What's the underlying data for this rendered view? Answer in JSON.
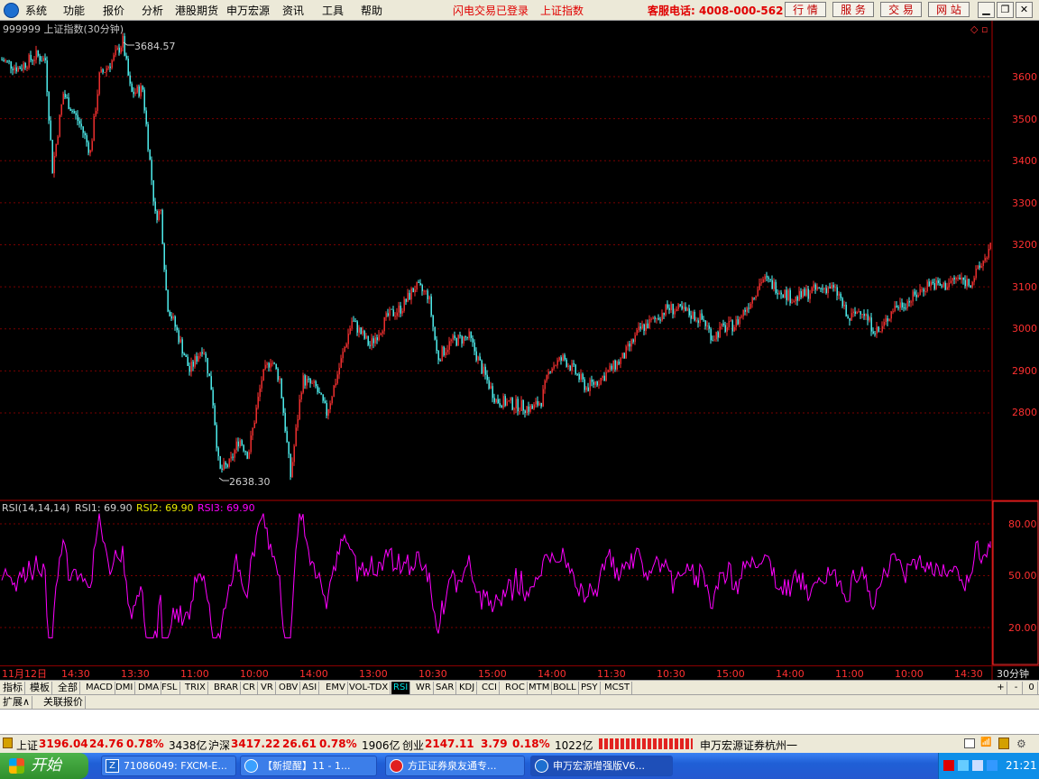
{
  "menu": {
    "items": [
      "系统",
      "功能",
      "报价",
      "分析",
      "港股期货",
      "申万宏源",
      "资讯",
      "工具",
      "帮助"
    ],
    "status1": "闪电交易已登录",
    "status2": "上证指数",
    "hotline": "客服电话: 4008-000-562",
    "nav_buttons": [
      "行 情",
      "服 务",
      "交 易",
      "网 站"
    ]
  },
  "chart": {
    "title": "999999 上证指数(30分钟)",
    "high_label": "3684.57",
    "low_label": "2638.30",
    "price_ticks": [
      "3600",
      "3500",
      "3400",
      "3300",
      "3200",
      "3100",
      "3000",
      "2900",
      "2800"
    ]
  },
  "rsi": {
    "name": "RSI(14,14,14)",
    "rsi1": "RSI1: 69.90",
    "rsi2": "RSI2: 69.90",
    "rsi3": "RSI3: 69.90",
    "ticks": [
      "80.00",
      "50.00",
      "20.00"
    ]
  },
  "time_axis": [
    "11月12日",
    "14:30",
    "13:30",
    "11:00",
    "10:00",
    "14:00",
    "13:00",
    "10:30",
    "15:00",
    "14:00",
    "11:30",
    "10:30",
    "15:00",
    "14:00",
    "11:00",
    "10:00",
    "14:30"
  ],
  "period_label": "30分钟",
  "indicator_tabs": [
    "指标",
    "模板",
    "全部",
    "MACD",
    "DMI",
    "DMA",
    "FSL",
    "TRIX",
    "BRAR",
    "CR",
    "VR",
    "OBV",
    "ASI",
    "EMV",
    "VOL-TDX",
    "RSI",
    "WR",
    "SAR",
    "KDJ",
    "CCI",
    "ROC",
    "MTM",
    "BOLL",
    "PSY",
    "MCST"
  ],
  "active_tab": "RSI",
  "zoom_buttons": [
    "+",
    "-",
    "0"
  ],
  "ext_tabs": [
    "扩展∧",
    "关联报价"
  ],
  "quotes": {
    "sh_label": "上证",
    "sh_value": "3196.04",
    "sh_change": "24.76",
    "sh_pct": "0.78%",
    "sh_amount": "3438亿",
    "hs_label": "沪深",
    "hs_value": "3417.22",
    "hs_change": "26.61",
    "hs_pct": "0.78%",
    "hs_amount": "1906亿",
    "cy_label": "创业",
    "cy_value": "2147.11",
    "cy_change": "3.79",
    "cy_pct": "0.18%",
    "cy_amount": "1022亿",
    "broker": "申万宏源证券杭州一"
  },
  "taskbar": {
    "start": "开始",
    "tasks": [
      "71086049: FXCM-E...",
      "【新提醒】11 - 1...",
      "方正证券泉友通专...",
      "申万宏源增强版V6..."
    ],
    "clock": "21:21"
  },
  "colors": {
    "up": "#ff3232",
    "down": "#54ffff",
    "rsi": "#ff00ff",
    "axis": "#b00000"
  }
}
